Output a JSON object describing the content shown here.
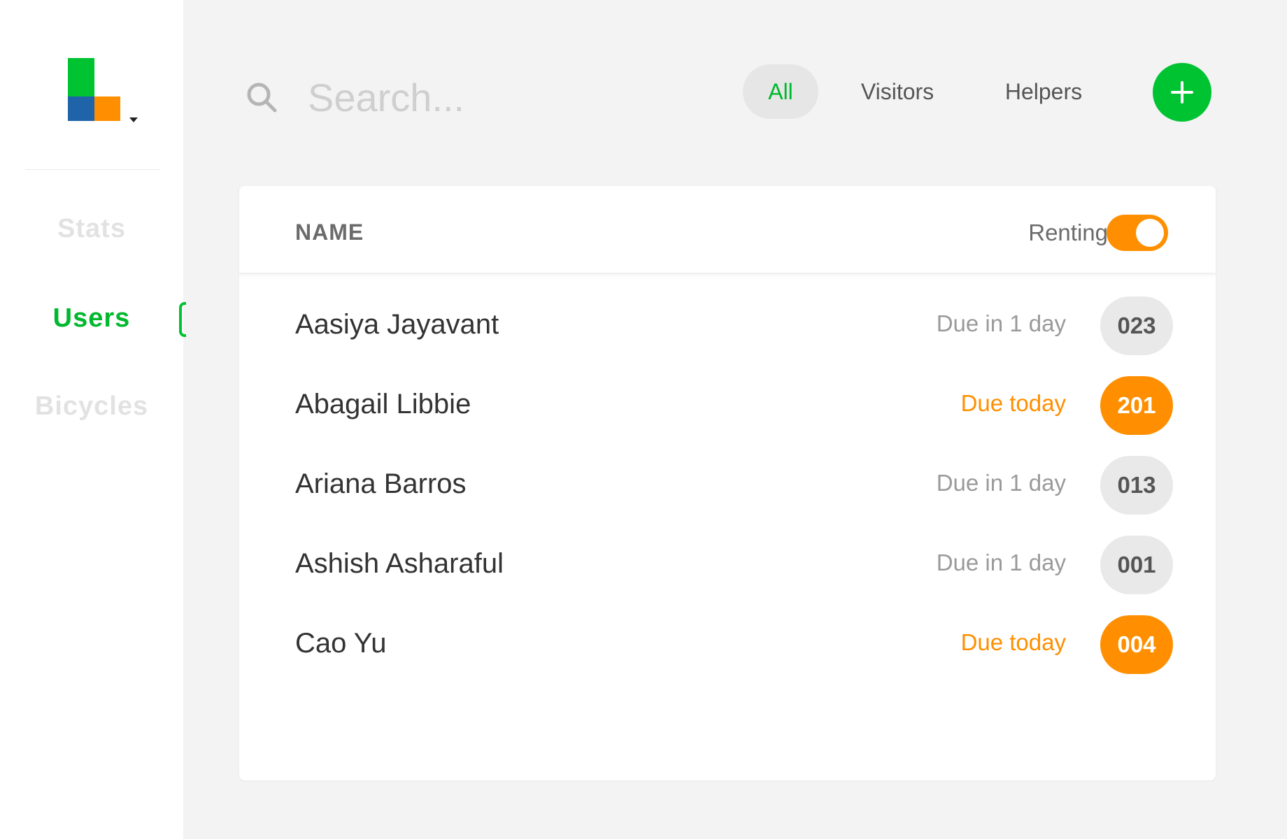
{
  "colors": {
    "brand_green": "#00c332",
    "brand_orange": "#ff8f00",
    "brand_blue": "#1f63a8"
  },
  "logo": {
    "icon": "app-logo-icon"
  },
  "sidebar": {
    "items": [
      {
        "label": "Stats",
        "active": false
      },
      {
        "label": "Users",
        "active": true
      },
      {
        "label": "Bicycles",
        "active": false
      }
    ]
  },
  "search": {
    "placeholder": "Search...",
    "icon": "search-icon"
  },
  "filters": [
    {
      "label": "All",
      "active": true
    },
    {
      "label": "Visitors",
      "active": false
    },
    {
      "label": "Helpers",
      "active": false
    }
  ],
  "add_button": {
    "icon": "plus-icon"
  },
  "table": {
    "name_header": "NAME",
    "renting_label": "Renting",
    "renting_enabled": true,
    "rows": [
      {
        "name": "Aasiya Jayavant",
        "due": "Due in 1 day",
        "badge": "023",
        "status": "normal"
      },
      {
        "name": "Abagail Libbie",
        "due": "Due today",
        "badge": "201",
        "status": "today"
      },
      {
        "name": "Ariana Barros",
        "due": "Due in 1 day",
        "badge": "013",
        "status": "normal"
      },
      {
        "name": "Ashish Asharaful",
        "due": "Due in 1 day",
        "badge": "001",
        "status": "normal"
      },
      {
        "name": "Cao Yu",
        "due": "Due today",
        "badge": "004",
        "status": "today"
      }
    ]
  }
}
